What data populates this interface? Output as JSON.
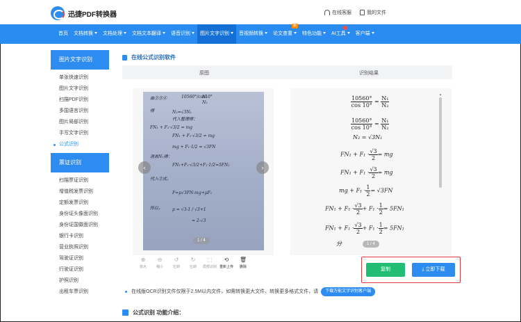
{
  "header": {
    "logo_text": "迅捷PDF转换器",
    "links": [
      {
        "label": "在线客服",
        "icon": "headset-icon"
      },
      {
        "label": "我的文件",
        "icon": "file-icon"
      }
    ]
  },
  "nav": {
    "items": [
      {
        "label": "首页",
        "dropdown": false
      },
      {
        "label": "文档转换",
        "dropdown": true
      },
      {
        "label": "文档处理",
        "dropdown": true
      },
      {
        "label": "文档文本翻译",
        "dropdown": true
      },
      {
        "label": "语音识别",
        "dropdown": true
      },
      {
        "label": "图片文字识别",
        "dropdown": true,
        "active": true
      },
      {
        "label": "音视频转换",
        "dropdown": true
      },
      {
        "label": "论文查重",
        "dropdown": true,
        "badge": "新"
      },
      {
        "label": "特色功能",
        "dropdown": true
      },
      {
        "label": "AI工具",
        "dropdown": true,
        "hot": true
      },
      {
        "label": "客户端",
        "dropdown": true
      }
    ]
  },
  "sidebar": {
    "groups": [
      {
        "title": "图片文字识别",
        "items": [
          "单张快速识别",
          "图片文字识别",
          "扫描PDF识别",
          "多国语言识别",
          "图片局部识别",
          "手写文字识别",
          "公式识别"
        ],
        "active_index": 6
      },
      {
        "title": "票证识别",
        "items": [
          "扫描票证识别",
          "增值税发票识别",
          "定额发票识别",
          "身份证头像面识别",
          "身份证国徽面识别",
          "银行卡识别",
          "营业执照识别",
          "驾驶证识别",
          "行驶证识别",
          "护照识别",
          "出租车票识别"
        ]
      }
    ]
  },
  "main": {
    "title": "在线公式识别软件",
    "col_original": "原图",
    "col_result": "识别结果",
    "preview": {
      "pager": "1 / 4",
      "prev": "‹",
      "next": "›",
      "handwriting": [
        "由②③④",
        "10560°/cos10°",
        "N₁",
        "N₂",
        "得",
        "N₂=√3N₁",
        "代入整理得：",
        "FN₁ + F₁·√3/2 = mg",
        "FN₁ + F₁·√3/2 = mg",
        "mg + F₁·1/2 = √3FN",
        "消去N₁得：",
        "FN₁+F₁·√3/2+F₁·1/2=5FN₁",
        "代入②式，",
        "F=μ√3FN-mg+μF₁",
        "所以，",
        "μ = √3-1 / √3+1",
        "= 2-√3"
      ]
    },
    "tools": [
      {
        "label": "放大",
        "icon": "zoom-in-icon",
        "glyph": "⊕"
      },
      {
        "label": "缩小",
        "icon": "zoom-out-icon",
        "glyph": "⊖"
      },
      {
        "label": "左转",
        "icon": "rotate-left-icon",
        "glyph": "↺"
      },
      {
        "label": "右转",
        "icon": "rotate-right-icon",
        "glyph": "↻"
      },
      {
        "label": "局部识别",
        "icon": "crop-icon",
        "glyph": "⬚"
      },
      {
        "label": "重新上传",
        "icon": "reupload-icon",
        "glyph": "⟲"
      },
      {
        "label": "删除",
        "icon": "trash-icon",
        "glyph": "🗑"
      }
    ],
    "result": {
      "pager": "1 / 4",
      "formulas": [
        {
          "num": "10560°",
          "den": "cos 10°",
          "rhs_num": "N₁",
          "rhs_den": "N₂"
        },
        {
          "num": "10560°",
          "den": "cos 10°",
          "rhs_num": "N₁",
          "rhs_den": "N₂"
        },
        {
          "text": "N₂ = √3N₁"
        },
        {
          "left": "FN₁ + F₁ ·",
          "num": "√3",
          "den": "2",
          "right": "= mg"
        },
        {
          "left": "FN₁ + F₁ ·",
          "num": "√3",
          "den": "2",
          "right": "= mg"
        },
        {
          "left": "mg + F₁ ·",
          "num": "1",
          "den": "2",
          "right": "= √3FN"
        },
        {
          "left": "FN₁ + F₁ ·",
          "num": "√3",
          "den": "2",
          "mid": "+ F₁ ·",
          "num2": "1",
          "den2": "2",
          "right": "= 5FN₁"
        },
        {
          "left": "FN₁ + F₁ ·",
          "num": "√3",
          "den": "2",
          "mid": "+ F₁ ·",
          "num2": "1",
          "den2": "2",
          "right": "= 5FN₁"
        },
        {
          "text": "分"
        }
      ]
    },
    "copy_label": "复制",
    "download_label": "立即下载",
    "notice_text": "在线版OCR识别文件仅限于2.5M以内文件，如需转换更大文件、转换更多格式文件，请",
    "notice_button": "下载万能文字识别客户端",
    "intro_title": "公式识别 功能介绍："
  }
}
